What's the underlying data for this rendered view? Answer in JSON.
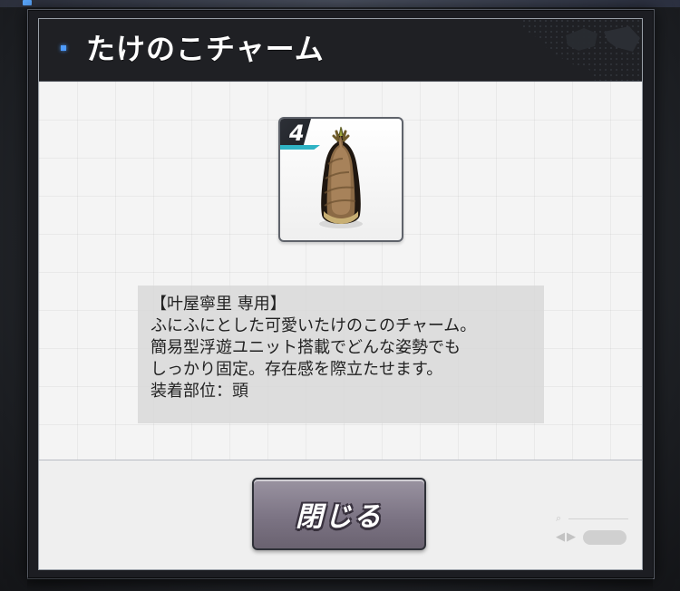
{
  "window": {
    "title": "たけのこチャーム"
  },
  "item": {
    "rarity": "4",
    "icon": "bamboo-shoot-icon"
  },
  "description": {
    "lines": [
      "【叶屋寧里 専用】",
      "ふにふにとした可愛いたけのこのチャーム。",
      "簡易型浮遊ユニット搭載でどんな姿勢でも",
      "しっかり固定。存在感を際立たせます。",
      "装着部位：頭"
    ]
  },
  "actions": {
    "close_label": "閉じる"
  },
  "colors": {
    "header_marker": "#4e9cff",
    "rarity_stripe": "#2fb3c4",
    "button_fill": "#7c7484"
  }
}
